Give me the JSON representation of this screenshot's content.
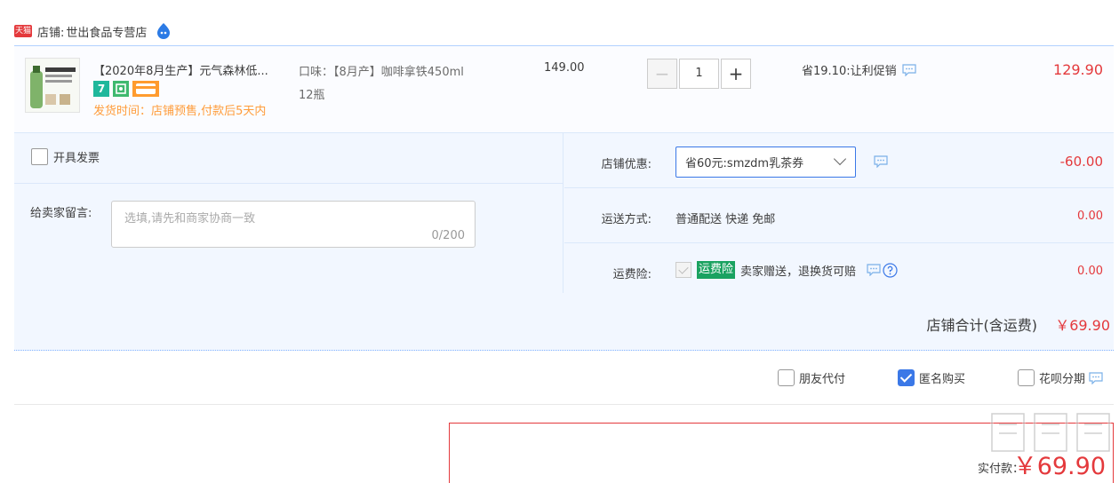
{
  "shop": {
    "tmall_badge": "天猫",
    "label": "店铺:",
    "name": "世出食品专营店"
  },
  "item": {
    "title": "【2020年8月生产】元气森林低...",
    "spec_line1": "口味：【8月产】咖啡拿铁450ml",
    "spec_line2": "12瓶",
    "badge_seven": "7",
    "delivery_note": "发货时间：店铺预售,付款后5天内",
    "original_price": "149.00",
    "quantity": "1",
    "qty_minus": "−",
    "qty_plus": "+",
    "promo": "省19.10:让利促销",
    "price": "129.90"
  },
  "options_left": {
    "invoice_label": "开具发票",
    "memo_label": "给卖家留言:",
    "memo_placeholder": "选填,请先和商家协商一致",
    "memo_count": "0/200"
  },
  "discount": {
    "label": "店铺优惠:",
    "selected": "省60元:smzdm乳茶券",
    "value": "-60.00"
  },
  "shipping": {
    "label": "运送方式:",
    "method": "普通配送 快递 免邮",
    "value": "0.00"
  },
  "insurance": {
    "label": "运费险:",
    "tag": "运费险",
    "desc": "卖家赠送，退换货可赔",
    "value": "0.00"
  },
  "total": {
    "label": "店铺合计(含运费)",
    "value": "￥69.90"
  },
  "payment_options": {
    "friend_pay": "朋友代付",
    "anonymous": "匿名购买",
    "huabei": "花呗分期"
  },
  "pay": {
    "label": "实付款：",
    "value": "￥69.90"
  },
  "colors": {
    "accent_red": "#e4393c",
    "accent_blue": "#3b78e7",
    "panel_bg": "#f2f7ff",
    "insurance_green": "#1aa260",
    "delivery_orange": "#ff9c3a"
  }
}
